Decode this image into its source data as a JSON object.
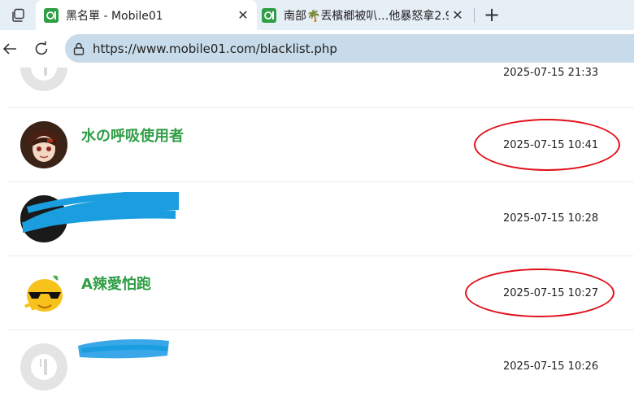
{
  "browser": {
    "tabs": [
      {
        "title": "黑名單 - Mobile01",
        "active": true,
        "favicon": "mobile01-favicon"
      },
      {
        "title": "南部🌴丟檳榔被叭…他暴怒拿2.9",
        "active": false,
        "favicon": "mobile01-favicon"
      }
    ],
    "url": "https://www.mobile01.com/blacklist.php"
  },
  "colors": {
    "brand_green": "#2f9e46",
    "annotation_red": "#e0101a",
    "scribble_blue": "#1a9ee0"
  },
  "blacklist": [
    {
      "name": "",
      "date": "2025-07-15 21:33",
      "avatar": "default-avatar-icon",
      "redacted": false,
      "circled": false
    },
    {
      "name": "水の呼吸使用者",
      "date": "2025-07-15 10:41",
      "avatar": "anime-avatar",
      "redacted": false,
      "circled": true
    },
    {
      "name": "",
      "date": "2025-07-15 10:28",
      "avatar": "redacted-avatar",
      "redacted": true,
      "circled": false
    },
    {
      "name": "A辣愛怕跑",
      "date": "2025-07-15 10:27",
      "avatar": "sunglasses-orange-avatar",
      "redacted": false,
      "circled": true
    },
    {
      "name": "",
      "date": "2025-07-15 10:26",
      "avatar": "default-avatar-icon",
      "redacted": true,
      "circled": false
    }
  ]
}
